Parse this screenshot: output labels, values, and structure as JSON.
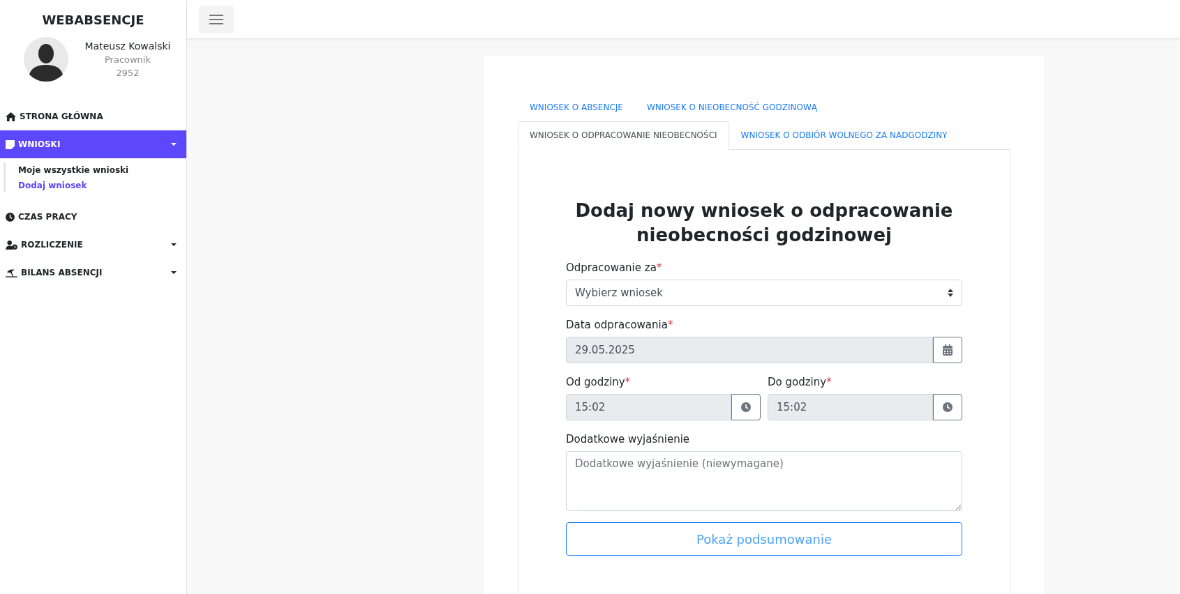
{
  "sidebar": {
    "brand": "WEBABSENCJE",
    "user": {
      "name": "Mateusz Kowalski",
      "role": "Pracownik",
      "number": "2952"
    },
    "items": [
      {
        "label": "STRONA GŁÓWNA",
        "selected": false,
        "has_submenu": false
      },
      {
        "label": "WNIOSKI",
        "selected": true,
        "has_submenu": true,
        "children": [
          {
            "label": "Moje wszystkie wnioski",
            "selected": false
          },
          {
            "label": "Dodaj wniosek",
            "selected": true
          }
        ]
      },
      {
        "label": "CZAS PRACY",
        "selected": false,
        "has_submenu": false
      },
      {
        "label": "ROZLICZENIE",
        "selected": false,
        "has_submenu": true
      },
      {
        "label": "BILANS ABSENCJI",
        "selected": false,
        "has_submenu": true
      }
    ]
  },
  "tabs": [
    {
      "label": "WNIOSEK O ABSENCJE",
      "selected": false
    },
    {
      "label": "WNIOSEK O NIEOBECNOŚĆ GODZINOWĄ",
      "selected": false
    },
    {
      "label": "WNIOSEK O ODPRACOWANIE NIEOBECNOŚCI",
      "selected": true
    },
    {
      "label": "WNIOSEK O ODBIÓR WOLNEGO ZA NADGODZINY",
      "selected": false
    }
  ],
  "form": {
    "title": "Dodaj nowy wniosek o odpracowanie nieobecności godzinowej",
    "request_select": {
      "label": "Odpracowanie za",
      "required_mark": "*",
      "value": "Wybierz wniosek"
    },
    "date": {
      "label": "Data odpracowania",
      "required_mark": "*",
      "value": "29.05.2025"
    },
    "times": [
      {
        "label": "Od godziny",
        "required_mark": "*",
        "value": "15:02"
      },
      {
        "label": "Do godziny",
        "required_mark": "*",
        "value": "15:02"
      }
    ],
    "note": {
      "label": "Dodatkowe wyjaśnienie",
      "placeholder": "Dodatkowe wyjaśnienie (niewymagane)"
    },
    "summary_button": "Pokaż podsumowanie"
  }
}
